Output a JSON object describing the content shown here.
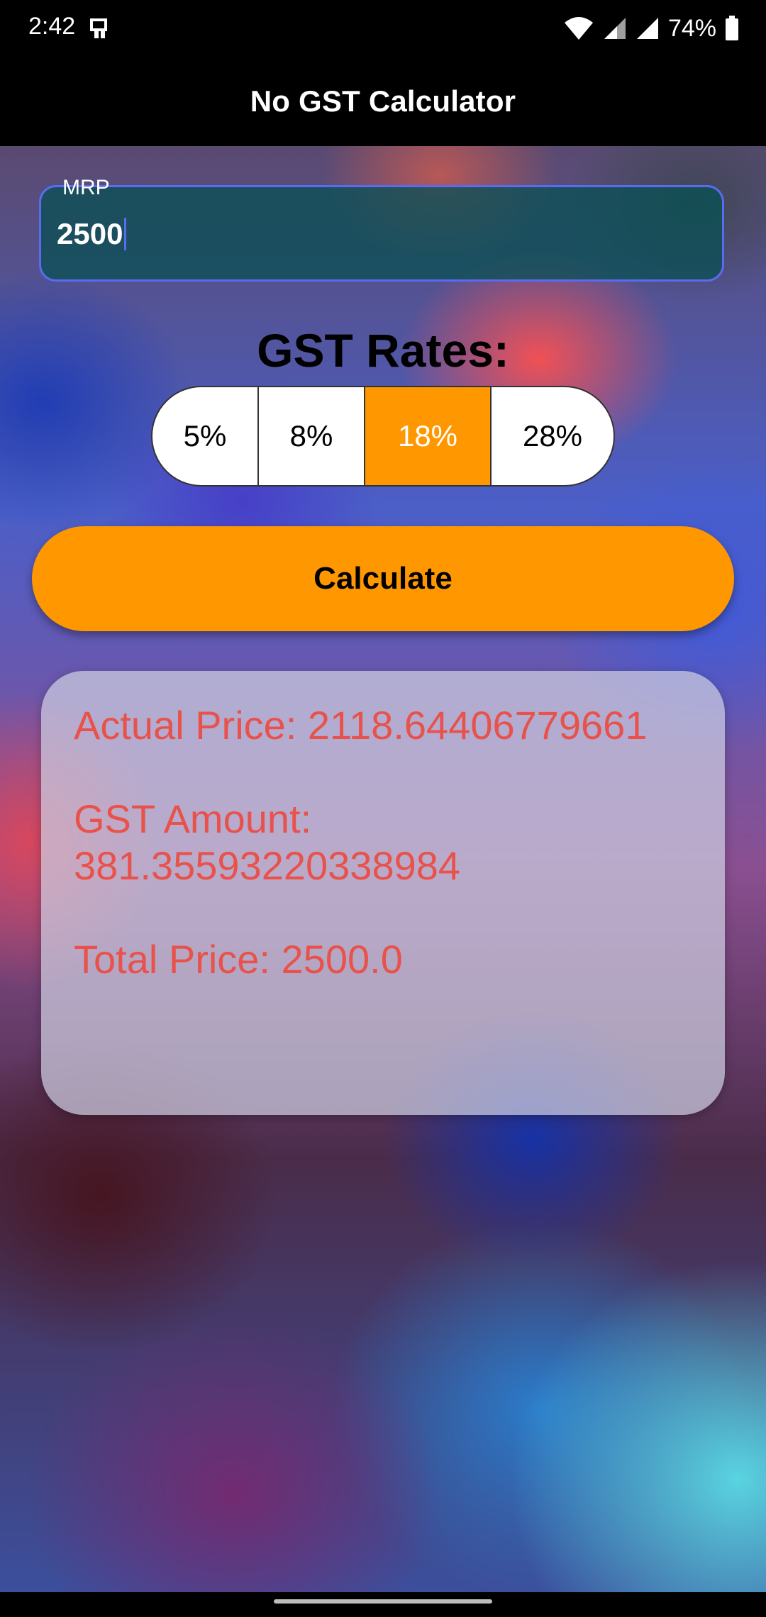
{
  "status_bar": {
    "time": "2:42",
    "battery": "74%",
    "icons": [
      "notification-app-icon",
      "wifi-icon",
      "signal-icon",
      "signal-icon",
      "battery-icon"
    ]
  },
  "app_bar": {
    "title": "No GST Calculator"
  },
  "mrp_field": {
    "label": "MRP",
    "value": "2500"
  },
  "gst_rates": {
    "title": "GST Rates:",
    "options": [
      "5%",
      "8%",
      "18%",
      "28%"
    ],
    "selected": "18%"
  },
  "calculate_button": {
    "label": "Calculate"
  },
  "result": {
    "actual_price": "Actual Price: 2118.64406779661",
    "gst_amount_label": "GST Amount:",
    "gst_amount_value": "381.35593220338984",
    "total_price": "Total Price: 2500.0"
  },
  "colors": {
    "accent": "#ff9800",
    "field_border": "#5b6bf0",
    "result_text": "#e8524a"
  }
}
